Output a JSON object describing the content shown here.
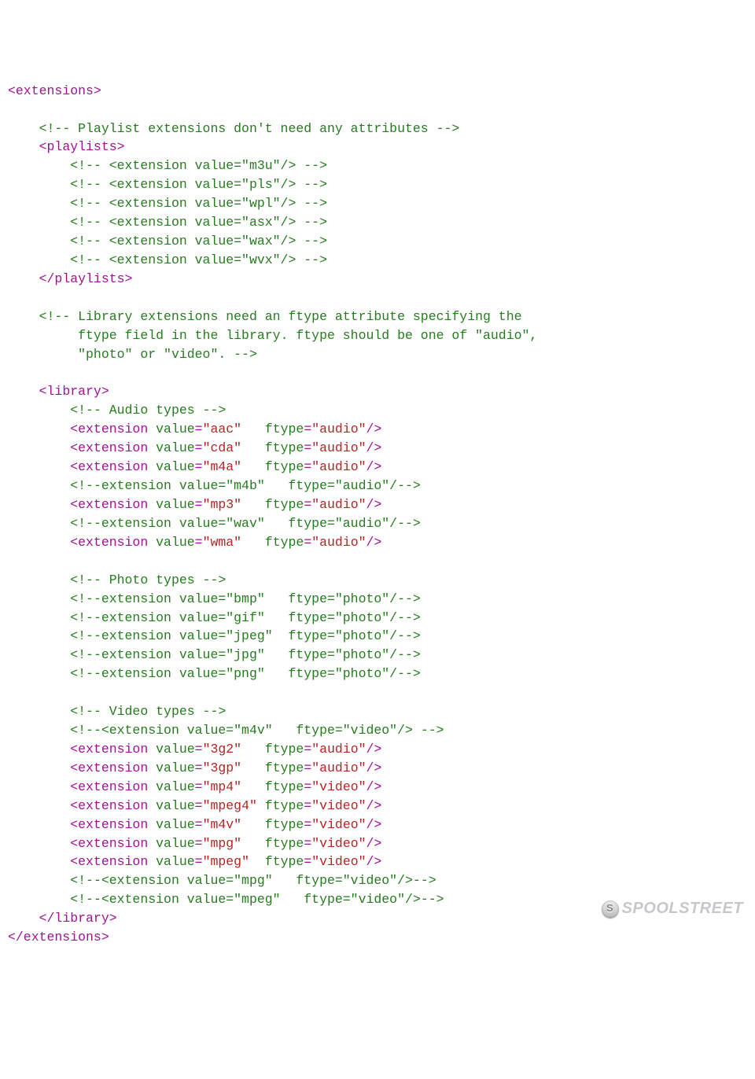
{
  "watermark": "SPOOLSTREET",
  "lines": [
    [
      [
        "tag",
        "<extensions>"
      ]
    ],
    [],
    [
      [
        "plain",
        "    "
      ],
      [
        "cmt",
        "<!-- Playlist extensions don't need any attributes -->"
      ]
    ],
    [
      [
        "plain",
        "    "
      ],
      [
        "tag",
        "<playlists>"
      ]
    ],
    [
      [
        "plain",
        "        "
      ],
      [
        "cmt",
        "<!-- <extension value=\"m3u\"/> -->"
      ]
    ],
    [
      [
        "plain",
        "        "
      ],
      [
        "cmt",
        "<!-- <extension value=\"pls\"/> -->"
      ]
    ],
    [
      [
        "plain",
        "        "
      ],
      [
        "cmt",
        "<!-- <extension value=\"wpl\"/> -->"
      ]
    ],
    [
      [
        "plain",
        "        "
      ],
      [
        "cmt",
        "<!-- <extension value=\"asx\"/> -->"
      ]
    ],
    [
      [
        "plain",
        "        "
      ],
      [
        "cmt",
        "<!-- <extension value=\"wax\"/> -->"
      ]
    ],
    [
      [
        "plain",
        "        "
      ],
      [
        "cmt",
        "<!-- <extension value=\"wvx\"/> -->"
      ]
    ],
    [
      [
        "plain",
        "    "
      ],
      [
        "tag",
        "</playlists>"
      ]
    ],
    [],
    [
      [
        "plain",
        "    "
      ],
      [
        "cmt",
        "<!-- Library extensions need an ftype attribute specifying the"
      ]
    ],
    [
      [
        "plain",
        "         "
      ],
      [
        "cmt",
        "ftype field in the library. ftype should be one of \"audio\","
      ]
    ],
    [
      [
        "plain",
        "         "
      ],
      [
        "cmt",
        "\"photo\" or \"video\". -->"
      ]
    ],
    [],
    [
      [
        "plain",
        "    "
      ],
      [
        "tag",
        "<library>"
      ]
    ],
    [
      [
        "plain",
        "        "
      ],
      [
        "cmt",
        "<!-- Audio types -->"
      ]
    ],
    [
      [
        "plain",
        "        "
      ],
      [
        "tag",
        "<extension "
      ],
      [
        "attr",
        "value"
      ],
      [
        "eq",
        "="
      ],
      [
        "str",
        "\"aac\""
      ],
      [
        "plain",
        "   "
      ],
      [
        "attr",
        "ftype"
      ],
      [
        "eq",
        "="
      ],
      [
        "str",
        "\"audio\""
      ],
      [
        "tag",
        "/>"
      ]
    ],
    [
      [
        "plain",
        "        "
      ],
      [
        "tag",
        "<extension "
      ],
      [
        "attr",
        "value"
      ],
      [
        "eq",
        "="
      ],
      [
        "str",
        "\"cda\""
      ],
      [
        "plain",
        "   "
      ],
      [
        "attr",
        "ftype"
      ],
      [
        "eq",
        "="
      ],
      [
        "str",
        "\"audio\""
      ],
      [
        "tag",
        "/>"
      ]
    ],
    [
      [
        "plain",
        "        "
      ],
      [
        "tag",
        "<extension "
      ],
      [
        "attr",
        "value"
      ],
      [
        "eq",
        "="
      ],
      [
        "str",
        "\"m4a\""
      ],
      [
        "plain",
        "   "
      ],
      [
        "attr",
        "ftype"
      ],
      [
        "eq",
        "="
      ],
      [
        "str",
        "\"audio\""
      ],
      [
        "tag",
        "/>"
      ]
    ],
    [
      [
        "plain",
        "        "
      ],
      [
        "cmt",
        "<!--extension value=\"m4b\"   ftype=\"audio\"/-->"
      ]
    ],
    [
      [
        "plain",
        "        "
      ],
      [
        "tag",
        "<extension "
      ],
      [
        "attr",
        "value"
      ],
      [
        "eq",
        "="
      ],
      [
        "str",
        "\"mp3\""
      ],
      [
        "plain",
        "   "
      ],
      [
        "attr",
        "ftype"
      ],
      [
        "eq",
        "="
      ],
      [
        "str",
        "\"audio\""
      ],
      [
        "tag",
        "/>"
      ]
    ],
    [
      [
        "plain",
        "        "
      ],
      [
        "cmt",
        "<!--extension value=\"wav\"   ftype=\"audio\"/-->"
      ]
    ],
    [
      [
        "plain",
        "        "
      ],
      [
        "tag",
        "<extension "
      ],
      [
        "attr",
        "value"
      ],
      [
        "eq",
        "="
      ],
      [
        "str",
        "\"wma\""
      ],
      [
        "plain",
        "   "
      ],
      [
        "attr",
        "ftype"
      ],
      [
        "eq",
        "="
      ],
      [
        "str",
        "\"audio\""
      ],
      [
        "tag",
        "/>"
      ]
    ],
    [],
    [
      [
        "plain",
        "        "
      ],
      [
        "cmt",
        "<!-- Photo types -->"
      ]
    ],
    [
      [
        "plain",
        "        "
      ],
      [
        "cmt",
        "<!--extension value=\"bmp\"   ftype=\"photo\"/-->"
      ]
    ],
    [
      [
        "plain",
        "        "
      ],
      [
        "cmt",
        "<!--extension value=\"gif\"   ftype=\"photo\"/-->"
      ]
    ],
    [
      [
        "plain",
        "        "
      ],
      [
        "cmt",
        "<!--extension value=\"jpeg\"  ftype=\"photo\"/-->"
      ]
    ],
    [
      [
        "plain",
        "        "
      ],
      [
        "cmt",
        "<!--extension value=\"jpg\"   ftype=\"photo\"/-->"
      ]
    ],
    [
      [
        "plain",
        "        "
      ],
      [
        "cmt",
        "<!--extension value=\"png\"   ftype=\"photo\"/-->"
      ]
    ],
    [],
    [
      [
        "plain",
        "        "
      ],
      [
        "cmt",
        "<!-- Video types -->"
      ]
    ],
    [
      [
        "plain",
        "        "
      ],
      [
        "cmt",
        "<!--<extension value=\"m4v\"   ftype=\"video\"/> -->"
      ]
    ],
    [
      [
        "plain",
        "        "
      ],
      [
        "tag",
        "<extension "
      ],
      [
        "attr",
        "value"
      ],
      [
        "eq",
        "="
      ],
      [
        "str",
        "\"3g2\""
      ],
      [
        "plain",
        "   "
      ],
      [
        "attr",
        "ftype"
      ],
      [
        "eq",
        "="
      ],
      [
        "str",
        "\"audio\""
      ],
      [
        "tag",
        "/>"
      ]
    ],
    [
      [
        "plain",
        "        "
      ],
      [
        "tag",
        "<extension "
      ],
      [
        "attr",
        "value"
      ],
      [
        "eq",
        "="
      ],
      [
        "str",
        "\"3gp\""
      ],
      [
        "plain",
        "   "
      ],
      [
        "attr",
        "ftype"
      ],
      [
        "eq",
        "="
      ],
      [
        "str",
        "\"audio\""
      ],
      [
        "tag",
        "/>"
      ]
    ],
    [
      [
        "plain",
        "        "
      ],
      [
        "tag",
        "<extension "
      ],
      [
        "attr",
        "value"
      ],
      [
        "eq",
        "="
      ],
      [
        "str",
        "\"mp4\""
      ],
      [
        "plain",
        "   "
      ],
      [
        "attr",
        "ftype"
      ],
      [
        "eq",
        "="
      ],
      [
        "str",
        "\"video\""
      ],
      [
        "tag",
        "/>"
      ]
    ],
    [
      [
        "plain",
        "        "
      ],
      [
        "tag",
        "<extension "
      ],
      [
        "attr",
        "value"
      ],
      [
        "eq",
        "="
      ],
      [
        "str",
        "\"mpeg4\""
      ],
      [
        "plain",
        " "
      ],
      [
        "attr",
        "ftype"
      ],
      [
        "eq",
        "="
      ],
      [
        "str",
        "\"video\""
      ],
      [
        "tag",
        "/>"
      ]
    ],
    [
      [
        "plain",
        "        "
      ],
      [
        "tag",
        "<extension "
      ],
      [
        "attr",
        "value"
      ],
      [
        "eq",
        "="
      ],
      [
        "str",
        "\"m4v\""
      ],
      [
        "plain",
        "   "
      ],
      [
        "attr",
        "ftype"
      ],
      [
        "eq",
        "="
      ],
      [
        "str",
        "\"video\""
      ],
      [
        "tag",
        "/>"
      ]
    ],
    [
      [
        "plain",
        "        "
      ],
      [
        "tag",
        "<extension "
      ],
      [
        "attr",
        "value"
      ],
      [
        "eq",
        "="
      ],
      [
        "str",
        "\"mpg\""
      ],
      [
        "plain",
        "   "
      ],
      [
        "attr",
        "ftype"
      ],
      [
        "eq",
        "="
      ],
      [
        "str",
        "\"video\""
      ],
      [
        "tag",
        "/>"
      ]
    ],
    [
      [
        "plain",
        "        "
      ],
      [
        "tag",
        "<extension "
      ],
      [
        "attr",
        "value"
      ],
      [
        "eq",
        "="
      ],
      [
        "str",
        "\"mpeg\""
      ],
      [
        "plain",
        "  "
      ],
      [
        "attr",
        "ftype"
      ],
      [
        "eq",
        "="
      ],
      [
        "str",
        "\"video\""
      ],
      [
        "tag",
        "/>"
      ]
    ],
    [
      [
        "plain",
        "        "
      ],
      [
        "cmt",
        "<!--<extension value=\"mpg\"   ftype=\"video\"/>-->"
      ]
    ],
    [
      [
        "plain",
        "        "
      ],
      [
        "cmt",
        "<!--<extension value=\"mpeg\"   ftype=\"video\"/>-->"
      ]
    ],
    [
      [
        "plain",
        "    "
      ],
      [
        "tag",
        "</library>"
      ]
    ],
    [
      [
        "tag",
        "</extensions>"
      ]
    ]
  ]
}
